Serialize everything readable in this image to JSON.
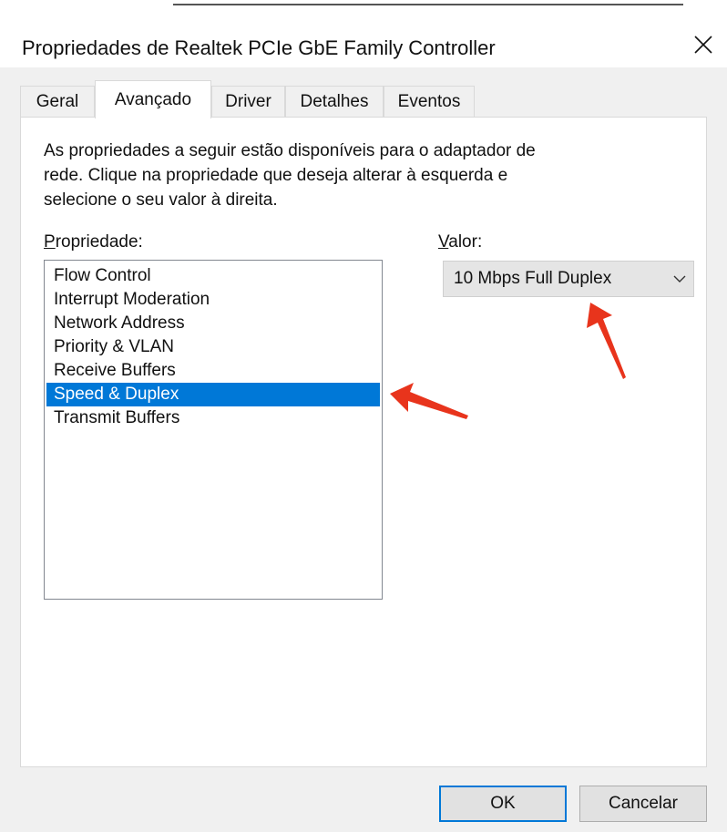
{
  "window": {
    "title": "Propriedades de Realtek PCIe GbE Family Controller",
    "close_label": "✕"
  },
  "tabs": [
    {
      "label": "Geral",
      "active": false
    },
    {
      "label": "Avançado",
      "active": true
    },
    {
      "label": "Driver",
      "active": false
    },
    {
      "label": "Detalhes",
      "active": false
    },
    {
      "label": "Eventos",
      "active": false
    }
  ],
  "advanced": {
    "description_lines": [
      "As propriedades a seguir estão disponíveis para o adaptador de",
      "rede. Clique na propriedade que deseja alterar à esquerda e",
      "selecione o seu valor à direita."
    ],
    "property_label_first": "P",
    "property_label_rest": "ropriedade:",
    "value_label_first": "V",
    "value_label_rest": "alor:",
    "properties": [
      "Flow Control",
      "Interrupt Moderation",
      "Network Address",
      "Priority & VLAN",
      "Receive Buffers",
      "Speed & Duplex",
      "Transmit Buffers"
    ],
    "selected_property": "Speed & Duplex",
    "value": "10 Mbps Full Duplex"
  },
  "buttons": {
    "ok": "OK",
    "cancel": "Cancelar"
  },
  "colors": {
    "selection": "#0078d7",
    "annotation_arrow": "#e8341c"
  },
  "icons": {
    "dropdown": "chevron-down-icon",
    "close": "close-icon"
  }
}
